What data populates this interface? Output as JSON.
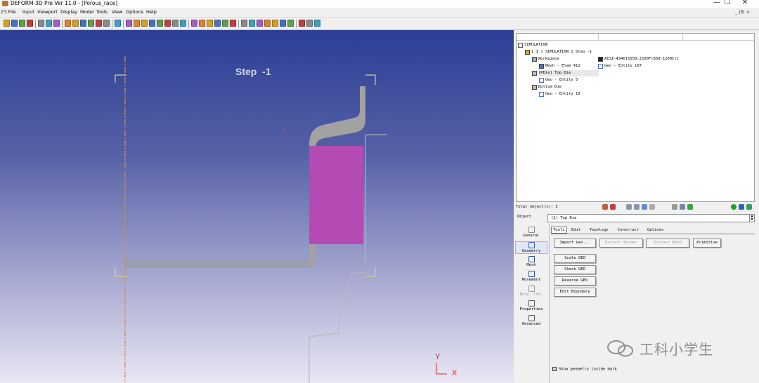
{
  "window": {
    "title": "DEFORM-3D Pre Ver 11.0 - [Porous_race]",
    "controls": [
      "—",
      "☐",
      "✕"
    ],
    "mdi_controls": "_ |ð| ×"
  },
  "menu": {
    "items": [
      "[⁴] File",
      "Input",
      "Viewport",
      "Display",
      "Model",
      "Tools",
      "View",
      "Options",
      "Help"
    ]
  },
  "toolbar": {
    "icons": [
      "open-icon",
      "save-icon",
      "save-as-icon",
      "print-icon",
      "camera-icon",
      "copy-icon",
      "settings-icon",
      "undo-icon",
      "view-cube-icon",
      "view-front-icon",
      "view-side-icon",
      "view-top-icon",
      "document-icon",
      "ruler-icon",
      "pointer-icon",
      "pan-icon",
      "zoom-icon",
      "zoom-box-icon",
      "rotate-icon",
      "rotate-x-icon",
      "rotate-y-icon",
      "rotate-z-icon",
      "section-1-icon",
      "section-2-icon",
      "section-3-icon",
      "section-4-icon",
      "section-5-icon",
      "section-6-icon",
      "mesh-tool-icon",
      "object-tool-icon",
      "boundary-icon",
      "paint-icon",
      "color-icon",
      "2d-icon",
      "3d-icon",
      "help-icon",
      "stop-icon",
      "exit-icon"
    ]
  },
  "viewport": {
    "step_label": "Step  -1",
    "axis_y": "Y",
    "axis_x": "X"
  },
  "tree": {
    "root": "SIMULATION",
    "sim": "[ I ]  SIMULATION 1  Step -1",
    "workpiece": "Workpiece",
    "workpiece_material": "AISI-4340[1550-2200F(850-1200C)]",
    "mesh": "Mesh - Elem 412",
    "geo_workpiece": "Geo - Entity 107",
    "topdie": "[PDie] Top Die",
    "geo_topdie": "Geo - Entity 5",
    "bottomdie": "Bottom Die",
    "geo_bottomdie": "Geo - Entity 10"
  },
  "status": {
    "total_objects": "Total object(s): 3"
  },
  "object_row": {
    "label": "Object",
    "selected": "(2) Top Die"
  },
  "left_icons": [
    {
      "name": "general",
      "label": "General"
    },
    {
      "name": "geometry",
      "label": "Geometry"
    },
    {
      "name": "mesh",
      "label": "Mesh"
    },
    {
      "name": "movement",
      "label": "Movement"
    },
    {
      "name": "bdry-cnd",
      "label": "Bdry. Cnd."
    },
    {
      "name": "properties",
      "label": "Properties"
    },
    {
      "name": "advanced",
      "label": "Advanced"
    }
  ],
  "tabs": [
    "Tools",
    "Edit",
    "Topology",
    "Construct",
    "Options"
  ],
  "buttons": {
    "import_geo": "Import Geo...",
    "extract_border": "Extract Border",
    "extract_mesh": "Extract Mesh",
    "primitive": "Primitive",
    "scale_geo": "Scale GEO",
    "check_geo": "Check GEO",
    "reverse_geo": "Reverse GEO",
    "edit_boundary": "Edit  Boundary"
  },
  "checkbox": {
    "label": "Show geometry inside mark",
    "checked": "☑"
  },
  "watermark": "工科小学生",
  "colors": {
    "workpiece": "#b44ab4",
    "die": "#a2a2a2",
    "symmetry_axis": "#e58a2e",
    "bracket": "#d6d08a",
    "axis_label": "#e02020"
  }
}
